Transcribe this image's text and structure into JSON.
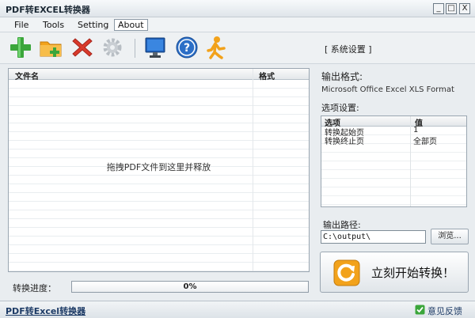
{
  "window": {
    "title": "PDF转EXCEL转换器",
    "controls": {
      "minimize": "_",
      "maximize": "□",
      "close": "X"
    }
  },
  "menu": {
    "items": [
      "File",
      "Tools",
      "Setting",
      "About"
    ],
    "active": "About"
  },
  "toolbar": {
    "icons": [
      "add-icon",
      "add-folder-icon",
      "delete-icon",
      "settings-gear-icon",
      "monitor-icon",
      "help-icon",
      "runner-icon"
    ],
    "system_settings": "[ 系统设置 ]"
  },
  "file_list": {
    "columns": [
      "文件名",
      "格式"
    ],
    "drop_hint": "拖拽PDF文件到这里并释放"
  },
  "progress": {
    "label": "转换进度：",
    "value": 0,
    "text": "0%"
  },
  "output": {
    "format_label": "输出格式:",
    "format_value": "Microsoft Office Excel XLS Format",
    "options_label": "选项设置:",
    "options_columns": [
      "选项",
      "值"
    ],
    "options": [
      {
        "name": "转换起始页",
        "value": "1"
      },
      {
        "name": "转换终止页",
        "value": "全部页"
      }
    ],
    "path_label": "输出路径:",
    "path_value": "C:\\output\\",
    "browse_label": "浏览...",
    "convert_label": "立刻开始转换！"
  },
  "status": {
    "link": "PDF转Excel转换器",
    "feedback": "意见反馈"
  },
  "colors": {
    "accent_green": "#3ba63b",
    "accent_orange": "#f2a21b",
    "delete_red": "#d93a2b",
    "help_blue": "#2c6fc7"
  }
}
